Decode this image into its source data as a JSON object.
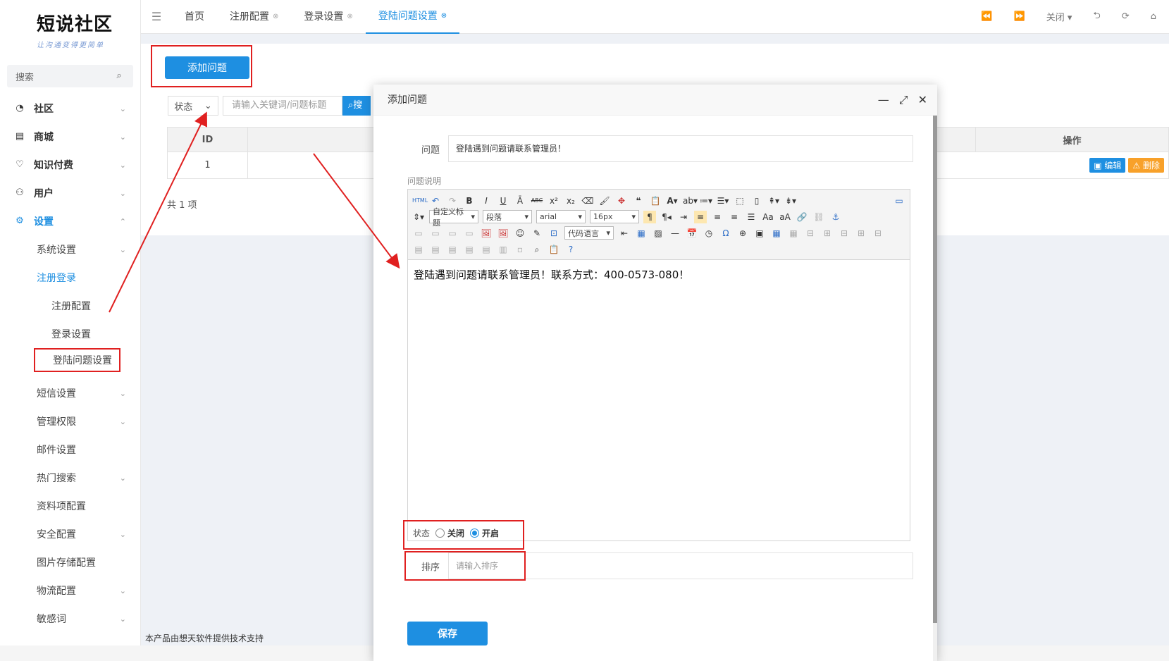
{
  "brand": {
    "title": "短说社区",
    "slogan": "让沟通变得更简单"
  },
  "sidebar": {
    "search_placeholder": "搜索",
    "items": [
      {
        "label": "社区",
        "icon": "chat-icon"
      },
      {
        "label": "商城",
        "icon": "shop-icon"
      },
      {
        "label": "知识付费",
        "icon": "bulb-icon"
      },
      {
        "label": "用户",
        "icon": "user-icon"
      },
      {
        "label": "设置",
        "icon": "gear-icon"
      }
    ],
    "settings_sub": [
      "系统设置",
      "注册登录"
    ],
    "login_sub": [
      "注册配置",
      "登录设置",
      "登陆问题设置"
    ],
    "more": [
      "短信设置",
      "管理权限",
      "邮件设置",
      "热门搜索",
      "资料项配置",
      "安全配置",
      "图片存储配置",
      "物流配置",
      "敏感词"
    ]
  },
  "topbar": {
    "tabs": [
      "首页",
      "注册配置",
      "登录设置",
      "登陆问题设置"
    ],
    "close_label": "关闭"
  },
  "page": {
    "add_button": "添加问题",
    "status_select": "状态",
    "keyword_placeholder": "请输入关键词/问题标题",
    "search_button": "搜索",
    "col_id": "ID",
    "col_op": "操作",
    "row_id": "1",
    "edit": "编辑",
    "delete": "删除",
    "total": "共 1 项",
    "footer": "本产品由想天软件提供技术支持"
  },
  "modal": {
    "title": "添加问题",
    "question_label": "问题",
    "question_value": "登陆遇到问题请联系管理员！",
    "desc_label": "问题说明",
    "editor_content": "登陆遇到问题请联系管理员！联系方式：400-0573-080！",
    "toolbar_selects": [
      "自定义标题",
      "段落",
      "arial",
      "16px",
      "代码语言"
    ],
    "status_label": "状态",
    "status_options": [
      "关闭",
      "开启"
    ],
    "status_selected": "开启",
    "sort_label": "排序",
    "sort_placeholder": "请输入排序",
    "save_button": "保存"
  },
  "colors": {
    "accent": "#1e8fe1",
    "annotation": "#e02020",
    "warning": "#f8a12a"
  }
}
